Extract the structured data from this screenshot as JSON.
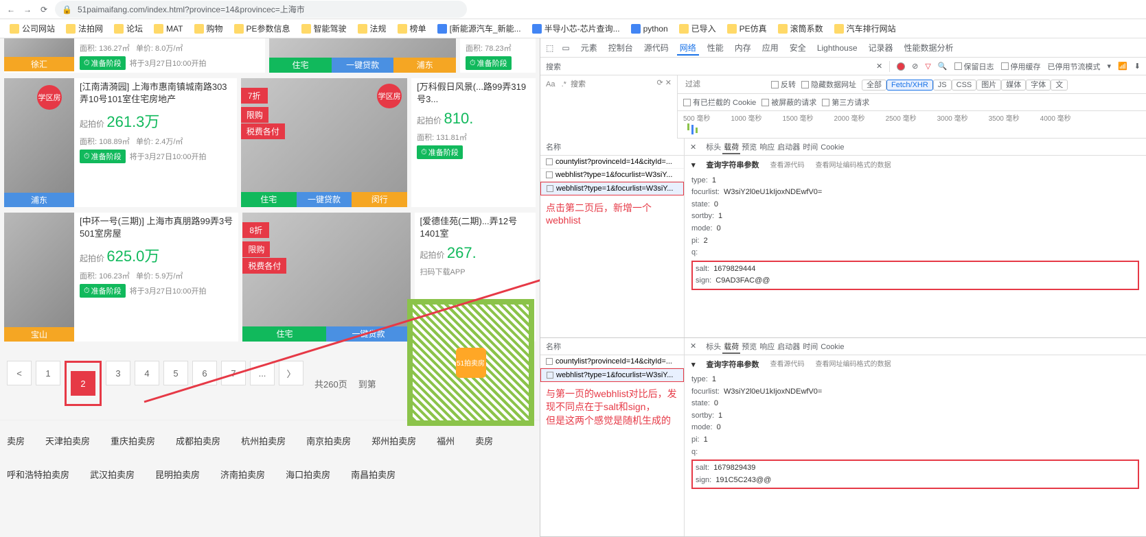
{
  "browser": {
    "url": "51paimaifang.com/index.html?province=14&provincec=上海市",
    "bookmarks": [
      "公司网站",
      "法拍网",
      "论坛",
      "MAT",
      "购物",
      "PE参数信息",
      "智能驾驶",
      "法规",
      "榜单",
      "[新能源汽车_新能...",
      "半导小芯-芯片查询...",
      "python",
      "已导入",
      "PE仿真",
      "滚筒系数",
      "汽车排行网站"
    ]
  },
  "listings": {
    "row1": {
      "card1": {
        "thumb_label": "徐汇",
        "area": "面积: 136.27㎡",
        "unit": "单价: 8.0万/㎡",
        "status": "准备阶段",
        "time": "将于3月27日10:00开拍"
      },
      "img_card": {
        "type": "住宅",
        "loan": "一键贷款",
        "district": "浦东"
      },
      "card2": {
        "area": "面积: 78.23㎡",
        "status": "准备阶段"
      }
    },
    "row2": {
      "card1": {
        "thumb_label": "浦东",
        "badge": "学区房",
        "title": "[江南清漪园] 上海市惠南镇城南路303弄10号101室住宅房地产",
        "price_label": "起拍价",
        "price": "261.3万",
        "area": "面积: 108.89㎡",
        "unit": "单价: 2.4万/㎡",
        "status": "准备阶段",
        "time": "将于3月27日10:00开拍"
      },
      "img_card": {
        "ribbon1": "7折",
        "ribbon2": "限购",
        "ribbon3": "税费各付",
        "badge": "学区房",
        "type": "住宅",
        "loan": "一键贷款",
        "district": "闵行"
      },
      "card2": {
        "title": "[万科假日风景(...路99弄319号3...",
        "price_label": "起拍价",
        "price": "810.",
        "area": "面积: 131.81㎡",
        "status": "准备阶段"
      }
    },
    "row3": {
      "card1": {
        "thumb_label": "宝山",
        "title": "[中环一号(三期)] 上海市真朋路99弄3号501室房屋",
        "price_label": "起拍价",
        "price": "625.0万",
        "area": "面积: 106.23㎡",
        "unit": "单价: 5.9万/㎡",
        "status": "准备阶段",
        "time": "将于3月27日10:00开拍"
      },
      "img_card": {
        "ribbon1": "8折",
        "ribbon2": "限购",
        "ribbon3": "税费各付",
        "type": "住宅",
        "loan": "一键贷款"
      },
      "card2": {
        "title": "[爱德佳苑(二期)...弄12号1401室",
        "price_label": "起拍价",
        "price": "267.",
        "app_text": "扫码下载APP"
      }
    }
  },
  "pagination": {
    "pages": [
      "<",
      "1",
      "2",
      "3",
      "4",
      "5",
      "6",
      "7",
      "...",
      "〉"
    ],
    "active": "2",
    "total": "共260页",
    "goto": "到第"
  },
  "qr": {
    "center": "51拍卖房"
  },
  "footer": [
    "卖房",
    "天津拍卖房",
    "重庆拍卖房",
    "成都拍卖房",
    "杭州拍卖房",
    "南京拍卖房",
    "郑州拍卖房",
    "福州",
    "卖房",
    "呼和浩特拍卖房",
    "武汉拍卖房",
    "昆明拍卖房",
    "济南拍卖房",
    "海口拍卖房",
    "南昌拍卖房"
  ],
  "annotations": {
    "a1": "点击第二页后，新增一个webhlist",
    "a2": "与第一页的webhlist对比后，发现不同点在于salt和sign，",
    "a3": "但是这两个感觉是随机生成的"
  },
  "devtools": {
    "tabs": [
      "元素",
      "控制台",
      "源代码",
      "网络",
      "性能",
      "内存",
      "应用",
      "安全",
      "Lighthouse",
      "记录器",
      "性能数据分析"
    ],
    "active_tab": "网络",
    "search_label": "搜索",
    "search_placeholder": "搜索",
    "filter_placeholder": "过滤",
    "options": [
      "保留日志",
      "停用缓存",
      "已停用节流模式",
      "反转",
      "隐藏数据网址"
    ],
    "filter_types": [
      "全部",
      "Fetch/XHR",
      "JS",
      "CSS",
      "图片",
      "媒体",
      "字体",
      "文"
    ],
    "cookie_opts": [
      "有已拦截的 Cookie",
      "被屏蔽的请求",
      "第三方请求"
    ],
    "timeline_ticks": [
      "500 毫秒",
      "1000 毫秒",
      "1500 毫秒",
      "2000 毫秒",
      "2500 毫秒",
      "3000 毫秒",
      "3500 毫秒",
      "4000 毫秒"
    ],
    "col_name": "名称",
    "pane_tabs": [
      "标头",
      "载荷",
      "预览",
      "响应",
      "启动器",
      "时间",
      "Cookie"
    ],
    "active_pane": "载荷",
    "requests1": [
      "countylist?provinceId=14&cityId=...",
      "webhlist?type=1&focurlist=W3siY...",
      "webhlist?type=1&focurlist=W3siY..."
    ],
    "requests2": [
      "countylist?provinceId=14&cityId=...",
      "webhlist?type=1&focurlist=W3siY..."
    ],
    "payload_title": "查询字符串参数",
    "view_source": "查看源代码",
    "view_encoded": "查看网址编码格式的数据",
    "payload1": {
      "type": "1",
      "focurlist": "W3siY2l0eU1kIjoxNDEwfV0=",
      "state": "0",
      "sortby": "1",
      "mode": "0",
      "pi": "2",
      "q": "",
      "salt": "1679829444",
      "sign": "C9AD3FAC@@"
    },
    "payload2": {
      "type": "1",
      "focurlist": "W3siY2l0eU1kIjoxNDEwfV0=",
      "state": "0",
      "sortby": "1",
      "mode": "0",
      "pi": "1",
      "q": "",
      "salt": "1679829439",
      "sign": "191C5C243@@"
    }
  }
}
